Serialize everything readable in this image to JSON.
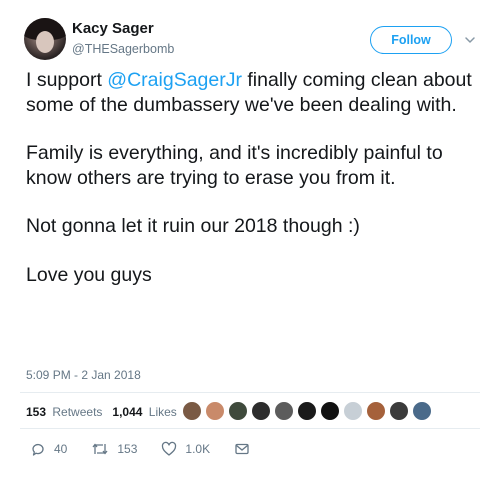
{
  "author": {
    "display_name": "Kacy Sager",
    "handle": "@THESagerbomb"
  },
  "follow_button": {
    "label": "Follow"
  },
  "tweet": {
    "line1_prefix": "I support ",
    "mention": "@CraigSagerJr",
    "line1_suffix": " finally coming clean about some of the dumbassery we've been dealing with.",
    "paragraph2": "Family is everything, and it's incredibly painful to know others are trying to erase you from it.",
    "paragraph3": "Not gonna let it ruin our 2018 though :)",
    "paragraph4": "Love you guys",
    "timestamp": "5:09 PM - 2 Jan 2018"
  },
  "stats": {
    "retweets_count": "153",
    "retweets_label": "Retweets",
    "likes_count": "1,044",
    "likes_label": "Likes"
  },
  "likers": [
    {
      "icon": "liker-avatar",
      "color": "#7a5a44"
    },
    {
      "icon": "liker-avatar",
      "color": "#c98a6a"
    },
    {
      "icon": "liker-avatar",
      "color": "#3f4a3c"
    },
    {
      "icon": "liker-avatar",
      "color": "#2d2d2d"
    },
    {
      "icon": "liker-avatar",
      "color": "#5c5c5c"
    },
    {
      "icon": "liker-avatar",
      "color": "#1a1a1a"
    },
    {
      "icon": "liker-avatar",
      "color": "#111111"
    },
    {
      "icon": "liker-avatar-default",
      "color": "#c7cfd6"
    },
    {
      "icon": "liker-avatar",
      "color": "#a5613b"
    },
    {
      "icon": "liker-avatar",
      "color": "#3b3b3b"
    },
    {
      "icon": "liker-avatar",
      "color": "#4a6a8a"
    }
  ],
  "actions": {
    "reply_count": "40",
    "retweet_count": "153",
    "like_count": "1.0K"
  },
  "colors": {
    "accent": "#1da1f2",
    "text": "#14171a",
    "secondary": "#657786"
  }
}
